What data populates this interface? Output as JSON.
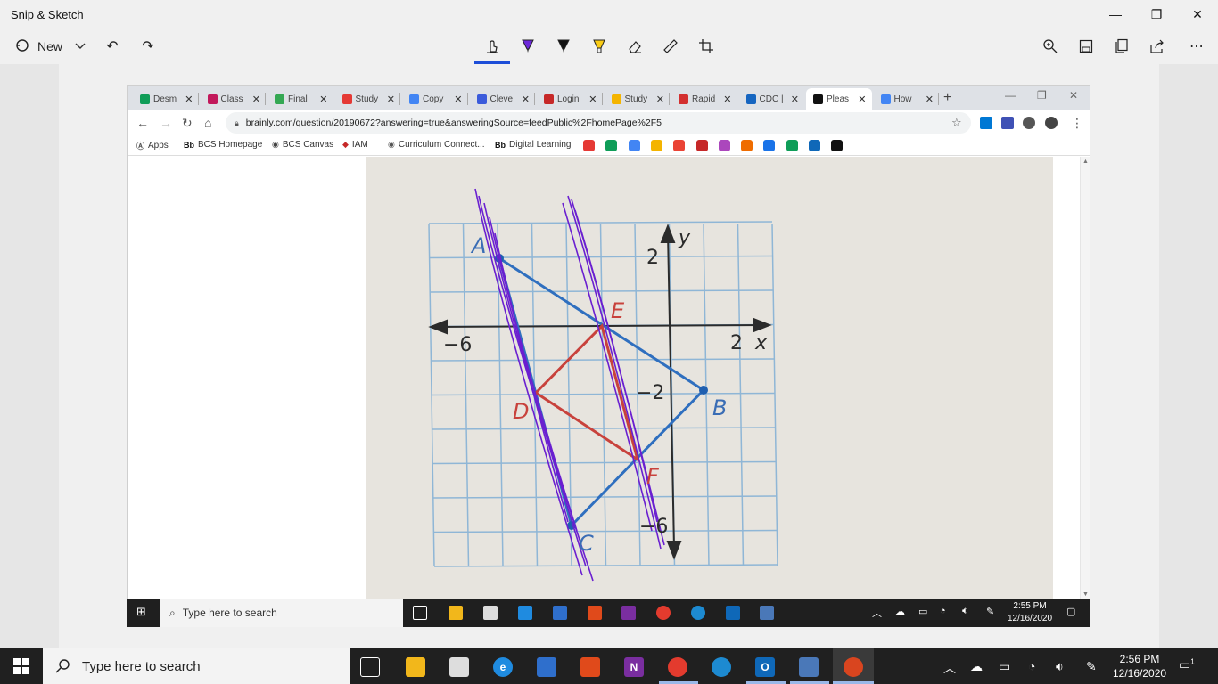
{
  "app": {
    "title": "Snip & Sketch",
    "new_label": "New"
  },
  "browser": {
    "tabs": [
      {
        "label": "Desm",
        "color": "#0f9d58"
      },
      {
        "label": "Class",
        "color": "#c2185b"
      },
      {
        "label": "Final",
        "color": "#34a853"
      },
      {
        "label": "Study",
        "color": "#e53935"
      },
      {
        "label": "Copy",
        "color": "#4285f4"
      },
      {
        "label": "Cleve",
        "color": "#3b5bdb"
      },
      {
        "label": "Login",
        "color": "#c62828"
      },
      {
        "label": "Study",
        "color": "#f4b400"
      },
      {
        "label": "Rapid",
        "color": "#d32f2f"
      },
      {
        "label": "CDC |",
        "color": "#1565c0"
      },
      {
        "label": "Pleas",
        "color": "#111111"
      },
      {
        "label": "How",
        "color": "#4285f4"
      }
    ],
    "url": "brainly.com/question/20190672?answering=true&answeringSource=feedPublic%2FhomePage%2F5",
    "bookmarks": [
      {
        "label": "Apps",
        "icon": "Ⓐ"
      },
      {
        "label": "BCS Homepage",
        "icon": "Bb"
      },
      {
        "label": "BCS Canvas",
        "icon": "◉"
      },
      {
        "label": "IAM",
        "icon": "◆"
      },
      {
        "label": "Curriculum Connect...",
        "icon": "◉"
      },
      {
        "label": "Digital Learning",
        "icon": "Bb"
      }
    ]
  },
  "graph": {
    "x_tick_left": "−6",
    "x_tick_right": "2",
    "y_tick_top": "2",
    "y_tick_mid": "−2",
    "y_tick_bottom": "−6",
    "x_axis_label": "x",
    "y_axis_label": "y",
    "point_a": "A",
    "point_b": "B",
    "point_c": "C",
    "point_d": "D",
    "point_e": "E",
    "point_f": "F"
  },
  "inner_taskbar": {
    "search_placeholder": "Type here to search",
    "time": "2:55 PM",
    "date": "12/16/2020"
  },
  "taskbar": {
    "search_placeholder": "Type here to search",
    "time": "2:56 PM",
    "date": "12/16/2020",
    "notification_count": "1"
  }
}
